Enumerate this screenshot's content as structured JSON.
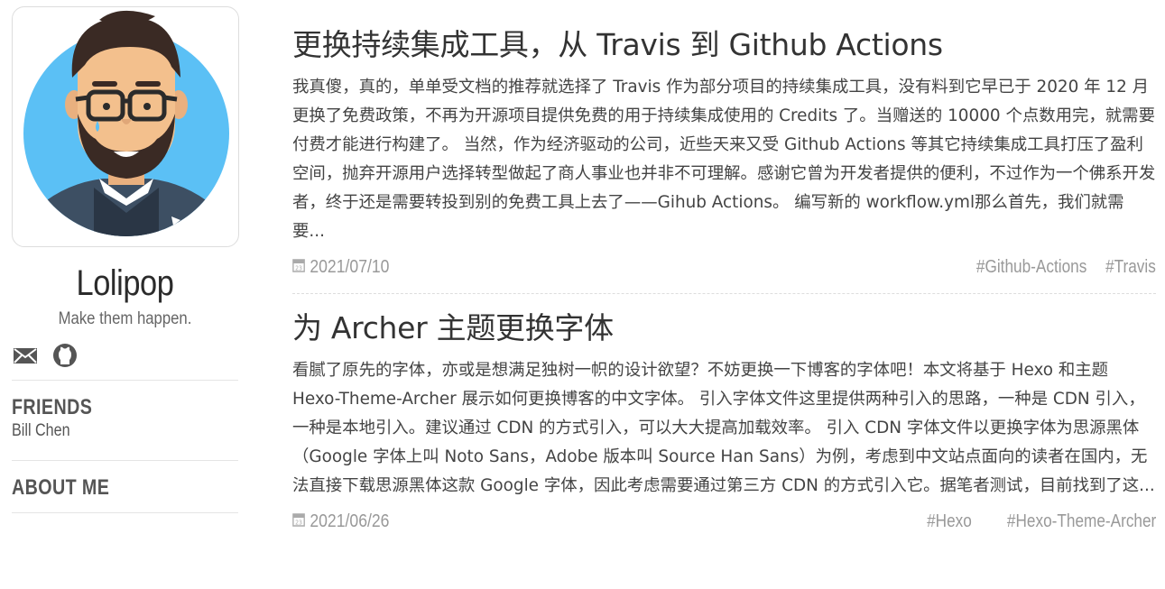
{
  "sidebar": {
    "author_name": "Lolipop",
    "motto": "Make them happen.",
    "friends_title": "FRIENDS",
    "friends": [
      "Bill Chen"
    ],
    "about_title": "ABOUT ME"
  },
  "posts": [
    {
      "title": "更换持续集成工具，从 Travis 到 Github Actions",
      "excerpt": "我真傻，真的，单单受文档的推荐就选择了 Travis 作为部分项目的持续集成工具，没有料到它早已于 2020 年 12 月更换了免费政策，不再为开源项目提供免费的用于持续集成使用的 Credits 了。当赠送的 10000 个点数用完，就需要付费才能进行构建了。 当然，作为经济驱动的公司，近些天来又受 Github Actions 等其它持续集成工具打压了盈利空间，抛弃开源用户选择转型做起了商人事业也并非不可理解。感谢它曾为开发者提供的便利，不过作为一个佛系开发者，终于还是需要转投到别的免费工具上去了——Gihub Actions。 编写新的 workflow.yml那么首先，我们就需要...",
      "date": "2021/07/10",
      "tags": [
        "#Github-Actions",
        "#Travis"
      ]
    },
    {
      "title": "为 Archer 主题更换字体",
      "excerpt": "看腻了原先的字体，亦或是想满足独树一帜的设计欲望？不妨更换一下博客的字体吧！本文将基于 Hexo 和主题 Hexo-Theme-Archer 展示如何更换博客的中文字体。 引入字体文件这里提供两种引入的思路，一种是 CDN 引入，一种是本地引入。建议通过 CDN 的方式引入，可以大大提高加载效率。 引入 CDN 字体文件以更换字体为思源黑体（Google 字体上叫 Noto Sans，Adobe 版本叫 Source Han Sans）为例，考虑到中文站点面向的读者在国内，无法直接下载思源黑体这款 Google 字体，因此考虑需要通过第三方 CDN 的方式引入它。据笔者测试，目前找到了这...",
      "date": "2021/06/26",
      "tags": [
        "#Hexo",
        "#Hexo-Theme-Archer"
      ]
    }
  ],
  "colors": {
    "avatar_bg": "#5bc0f5",
    "meta_text": "#999999"
  },
  "icons": {
    "social": [
      "mail-icon",
      "github-icon"
    ],
    "date": "calendar-icon"
  }
}
